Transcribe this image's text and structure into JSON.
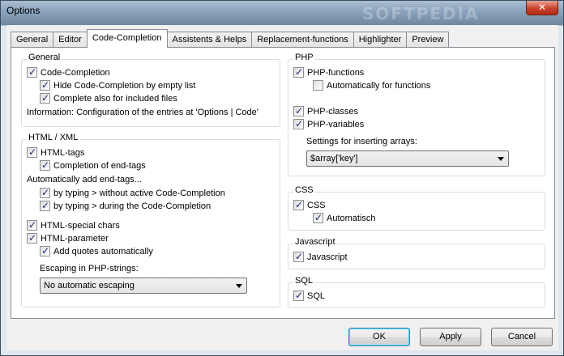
{
  "window": {
    "title": "Options",
    "watermark": "SOFTPEDIA",
    "close_glyph": "✕"
  },
  "tabs": [
    {
      "label": "General"
    },
    {
      "label": "Editor"
    },
    {
      "label": "Code-Completion",
      "active": true
    },
    {
      "label": "Assistents & Helps"
    },
    {
      "label": "Replacement-functions"
    },
    {
      "label": "Highlighter"
    },
    {
      "label": "Preview"
    }
  ],
  "general": {
    "legend": "General",
    "code_completion": {
      "label": "Code-Completion",
      "checked": true
    },
    "hide_empty": {
      "label": "Hide Code-Completion by empty list",
      "checked": true
    },
    "complete_included": {
      "label": "Complete also for included files",
      "checked": true
    },
    "info": "Information: Configuration of the entries at 'Options | Code'"
  },
  "html": {
    "legend": "HTML / XML",
    "html_tags": {
      "label": "HTML-tags",
      "checked": true
    },
    "end_tags": {
      "label": "Completion of end-tags",
      "checked": true
    },
    "auto_end_label": "Automatically add end-tags...",
    "typing_without": {
      "label": "by typing > without active Code-Completion",
      "checked": true
    },
    "typing_during": {
      "label": "by typing > during the Code-Completion",
      "checked": true
    },
    "special_chars": {
      "label": "HTML-special chars",
      "checked": true
    },
    "parameter": {
      "label": "HTML-parameter",
      "checked": true
    },
    "add_quotes": {
      "label": "Add quotes automatically",
      "checked": true
    },
    "escaping_label": "Escaping in PHP-strings:",
    "escaping_value": "No automatic escaping"
  },
  "php": {
    "legend": "PHP",
    "functions": {
      "label": "PHP-functions",
      "checked": true
    },
    "auto_functions": {
      "label": "Automatically for functions",
      "checked": false
    },
    "classes": {
      "label": "PHP-classes",
      "checked": true
    },
    "variables": {
      "label": "PHP-variables",
      "checked": true
    },
    "arrays_label": "Settings for inserting arrays:",
    "arrays_value": "$array['key']"
  },
  "css": {
    "legend": "CSS",
    "css": {
      "label": "CSS",
      "checked": true
    },
    "auto": {
      "label": "Automatisch",
      "checked": true
    }
  },
  "javascript": {
    "legend": "Javascript",
    "js": {
      "label": "Javascript",
      "checked": true
    }
  },
  "sql": {
    "legend": "SQL",
    "sql": {
      "label": "SQL",
      "checked": true
    }
  },
  "buttons": {
    "ok": "OK",
    "apply": "Apply",
    "cancel": "Cancel"
  },
  "icons": {
    "check_glyph": "✓"
  }
}
